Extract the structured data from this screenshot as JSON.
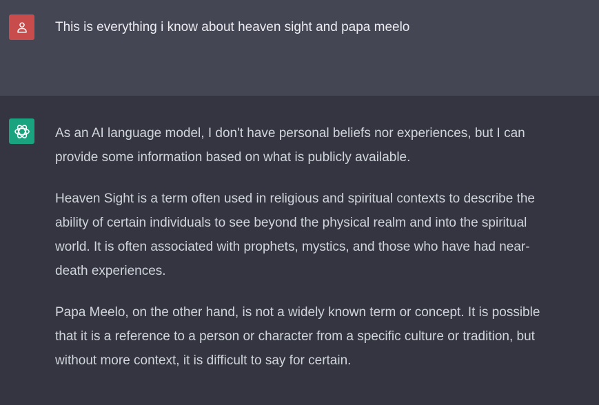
{
  "conversation": {
    "user_message": {
      "icon": "user-icon",
      "avatar_color": "#c94c4c",
      "text": "This is everything i know about heaven sight and papa meelo"
    },
    "assistant_message": {
      "icon": "openai-logo-icon",
      "avatar_color": "#19a37f",
      "paragraphs": [
        "As an AI language model, I don't have personal beliefs nor experiences, but I can provide some information based on what is publicly available.",
        "Heaven Sight is a term often used in religious and spiritual contexts to describe the ability of certain individuals to see beyond the physical realm and into the spiritual world. It is often associated with prophets, mystics, and those who have had near-death experiences.",
        "Papa Meelo, on the other hand, is not a widely known term or concept. It is possible that it is a reference to a person or character from a specific culture or tradition, but without more context, it is difficult to say for certain."
      ]
    }
  }
}
